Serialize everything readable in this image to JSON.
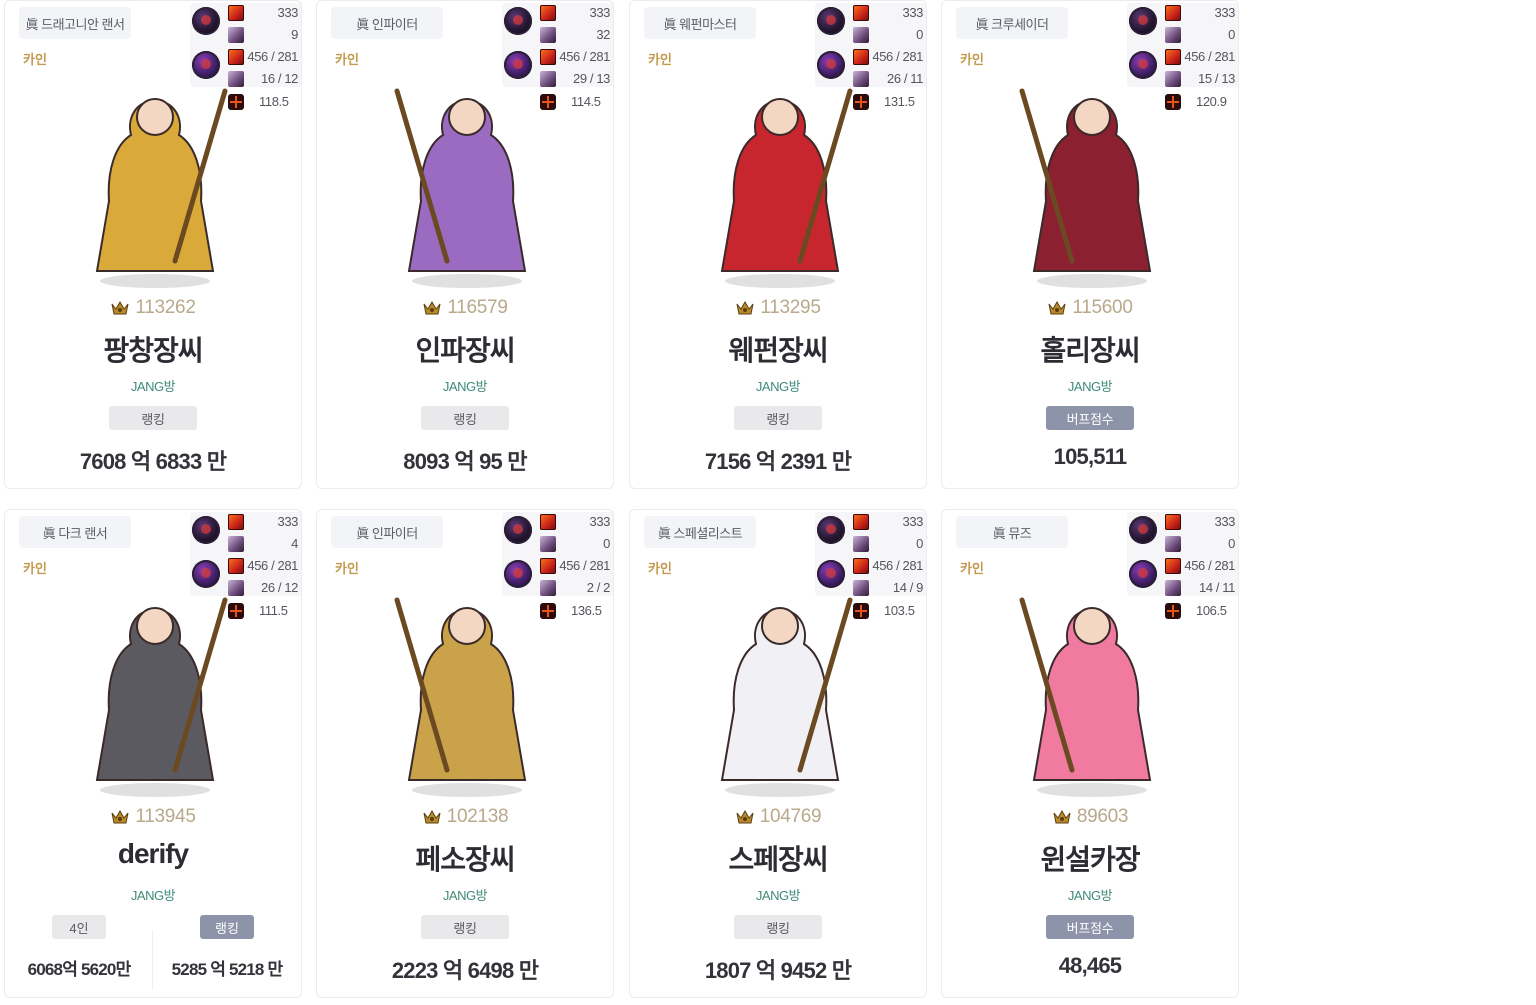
{
  "ranking_label": "랭킹",
  "buff_label": "버프점수",
  "cards": [
    {
      "job": "眞 드래고니안 랜서",
      "server": "카인",
      "stats": [
        "333",
        "9",
        "456 / 281",
        "16 / 12",
        "118.5"
      ],
      "score": "113262",
      "name": "팡창장씨",
      "guild": "JANG방",
      "pill": "랭킹",
      "value": "7608 억 6833 만",
      "char_color": "#d9a93a"
    },
    {
      "job": "眞 인파이터",
      "server": "카인",
      "stats": [
        "333",
        "32",
        "456 / 281",
        "29 / 13",
        "114.5"
      ],
      "score": "116579",
      "name": "인파장씨",
      "guild": "JANG방",
      "pill": "랭킹",
      "value": "8093 억 95 만",
      "char_color": "#9a6bc0"
    },
    {
      "job": "眞 웨펀마스터",
      "server": "카인",
      "stats": [
        "333",
        "0",
        "456 / 281",
        "26 / 11",
        "131.5"
      ],
      "score": "113295",
      "name": "웨펀장씨",
      "guild": "JANG방",
      "pill": "랭킹",
      "value": "7156 억 2391 만",
      "char_color": "#c8262e"
    },
    {
      "job": "眞 크루세이더",
      "server": "카인",
      "stats": [
        "333",
        "0",
        "456 / 281",
        "15 / 13",
        "120.9"
      ],
      "score": "115600",
      "name": "홀리장씨",
      "guild": "JANG방",
      "pill": "버프점수",
      "value": "105,511",
      "char_color": "#8a2030"
    },
    {
      "job": "眞 다크 랜서",
      "server": "카인",
      "stats": [
        "333",
        "4",
        "456 / 281",
        "26 / 12",
        "111.5"
      ],
      "score": "113945",
      "name": "derify",
      "guild": "JANG방",
      "split": {
        "left_pill": "4인",
        "left_value": "6068억 5620만",
        "right_pill": "랭킹",
        "right_value": "5285 억 5218 만"
      },
      "char_color": "#5b5a60"
    },
    {
      "job": "眞 인파이터",
      "server": "카인",
      "stats": [
        "333",
        "0",
        "456 / 281",
        "2 / 2",
        "136.5"
      ],
      "score": "102138",
      "name": "페소장씨",
      "guild": "JANG방",
      "pill": "랭킹",
      "value": "2223 억 6498 만",
      "char_color": "#c9a24a"
    },
    {
      "job": "眞 스페셜리스트",
      "server": "카인",
      "stats": [
        "333",
        "0",
        "456 / 281",
        "14 / 9",
        "103.5"
      ],
      "score": "104769",
      "name": "스페장씨",
      "guild": "JANG방",
      "pill": "랭킹",
      "value": "1807 억 9452 만",
      "char_color": "#f1f1f5"
    },
    {
      "job": "眞 뮤즈",
      "server": "카인",
      "stats": [
        "333",
        "0",
        "456 / 281",
        "14 / 11",
        "106.5"
      ],
      "score": "89603",
      "name": "윈설카장",
      "guild": "JANG방",
      "pill": "버프점수",
      "value": "48,465",
      "char_color": "#f07aa0"
    }
  ]
}
